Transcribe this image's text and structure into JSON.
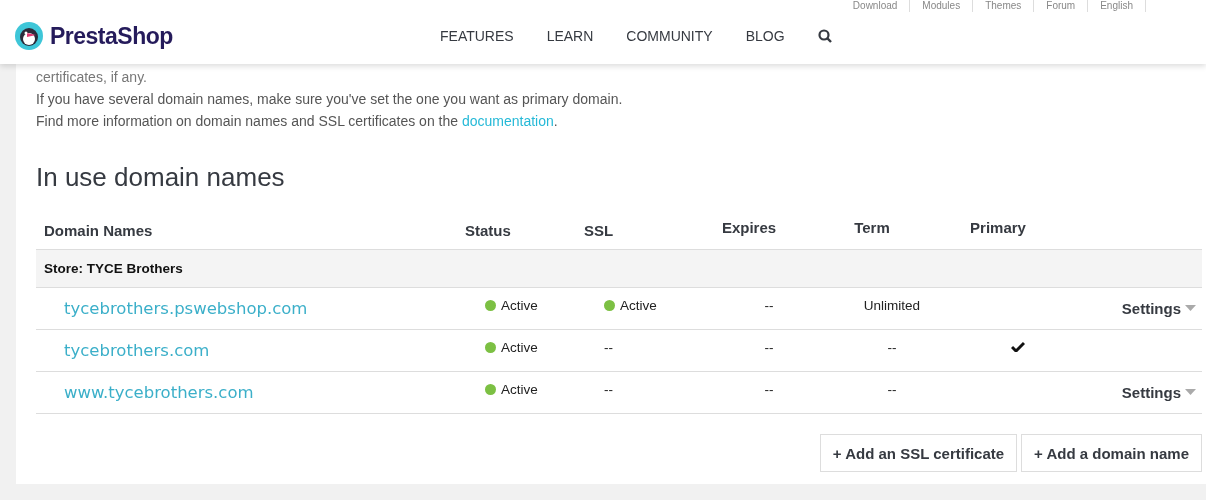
{
  "top_links": [
    "Download",
    "Modules",
    "Themes",
    "Forum",
    "English"
  ],
  "header": {
    "logo": "PrestaShop",
    "nav": [
      {
        "label": "FEATURES"
      },
      {
        "label": "LEARN"
      },
      {
        "label": "COMMUNITY"
      },
      {
        "label": "BLOG"
      }
    ]
  },
  "intro": {
    "cut_line": "certificates, if any.",
    "line": "If you have several domain names, make sure you've set the one you want as primary domain.",
    "info": "Find more information on domain names and SSL certificates on the ",
    "link": "documentation",
    "after": "."
  },
  "section_title": "In use domain names",
  "table": {
    "columns": [
      "Domain Names",
      "Status",
      "SSL",
      "Expires",
      "Term",
      "Primary"
    ],
    "group": "Store: TYCE Brothers",
    "rows": [
      {
        "domain": "tycebrothers.pswebshop.com",
        "status": {
          "text": "Active",
          "color": "#7cc043"
        },
        "ssl": {
          "text": "Active",
          "color": "#7cc043"
        },
        "expires": "--",
        "term": "Unlimited",
        "primary": false,
        "settings": "Settings"
      },
      {
        "domain": "tycebrothers.com",
        "status": {
          "text": "Active",
          "color": "#7cc043"
        },
        "ssl": {
          "text": "--"
        },
        "expires": "--",
        "term": "--",
        "primary": true
      },
      {
        "domain": "www.tycebrothers.com",
        "status": {
          "text": "Active",
          "color": "#7cc043"
        },
        "ssl": {
          "text": "--"
        },
        "expires": "--",
        "term": "--",
        "primary": false,
        "settings": "Settings"
      }
    ]
  },
  "buttons": [
    "+ Add an SSL certificate",
    "+ Add a domain name"
  ]
}
